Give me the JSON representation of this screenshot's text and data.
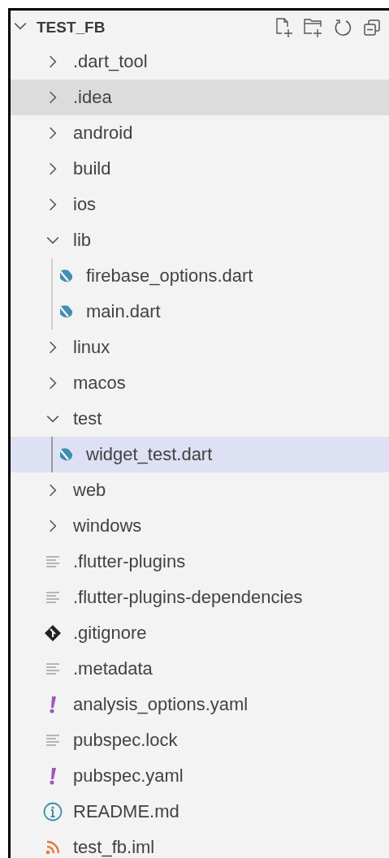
{
  "explorer": {
    "title": "TEST_FB",
    "expanded": true,
    "children": [
      {
        "name": ".dart_tool",
        "kind": "folder",
        "expanded": false,
        "selected": false,
        "hovered": false
      },
      {
        "name": ".idea",
        "kind": "folder",
        "expanded": false,
        "selected": false,
        "hovered": true
      },
      {
        "name": "android",
        "kind": "folder",
        "expanded": false,
        "selected": false,
        "hovered": false
      },
      {
        "name": "build",
        "kind": "folder",
        "expanded": false,
        "selected": false,
        "hovered": false
      },
      {
        "name": "ios",
        "kind": "folder",
        "expanded": false,
        "selected": false,
        "hovered": false
      },
      {
        "name": "lib",
        "kind": "folder",
        "expanded": true,
        "selected": false,
        "hovered": false,
        "children": [
          {
            "name": "firebase_options.dart",
            "kind": "dart",
            "selected": false,
            "hovered": false
          },
          {
            "name": "main.dart",
            "kind": "dart",
            "selected": false,
            "hovered": false
          }
        ]
      },
      {
        "name": "linux",
        "kind": "folder",
        "expanded": false,
        "selected": false,
        "hovered": false
      },
      {
        "name": "macos",
        "kind": "folder",
        "expanded": false,
        "selected": false,
        "hovered": false
      },
      {
        "name": "test",
        "kind": "folder",
        "expanded": true,
        "selected": false,
        "hovered": false,
        "children": [
          {
            "name": "widget_test.dart",
            "kind": "dart",
            "selected": true,
            "hovered": false
          }
        ]
      },
      {
        "name": "web",
        "kind": "folder",
        "expanded": false,
        "selected": false,
        "hovered": false
      },
      {
        "name": "windows",
        "kind": "folder",
        "expanded": false,
        "selected": false,
        "hovered": false
      },
      {
        "name": ".flutter-plugins",
        "kind": "text",
        "selected": false,
        "hovered": false
      },
      {
        "name": ".flutter-plugins-dependencies",
        "kind": "text",
        "selected": false,
        "hovered": false
      },
      {
        "name": ".gitignore",
        "kind": "git",
        "selected": false,
        "hovered": false
      },
      {
        "name": ".metadata",
        "kind": "text",
        "selected": false,
        "hovered": false
      },
      {
        "name": "analysis_options.yaml",
        "kind": "yaml",
        "selected": false,
        "hovered": false
      },
      {
        "name": "pubspec.lock",
        "kind": "text",
        "selected": false,
        "hovered": false
      },
      {
        "name": "pubspec.yaml",
        "kind": "yaml",
        "selected": false,
        "hovered": false
      },
      {
        "name": "README.md",
        "kind": "info",
        "selected": false,
        "hovered": false
      },
      {
        "name": "test_fb.iml",
        "kind": "feed",
        "selected": false,
        "hovered": false
      }
    ]
  }
}
